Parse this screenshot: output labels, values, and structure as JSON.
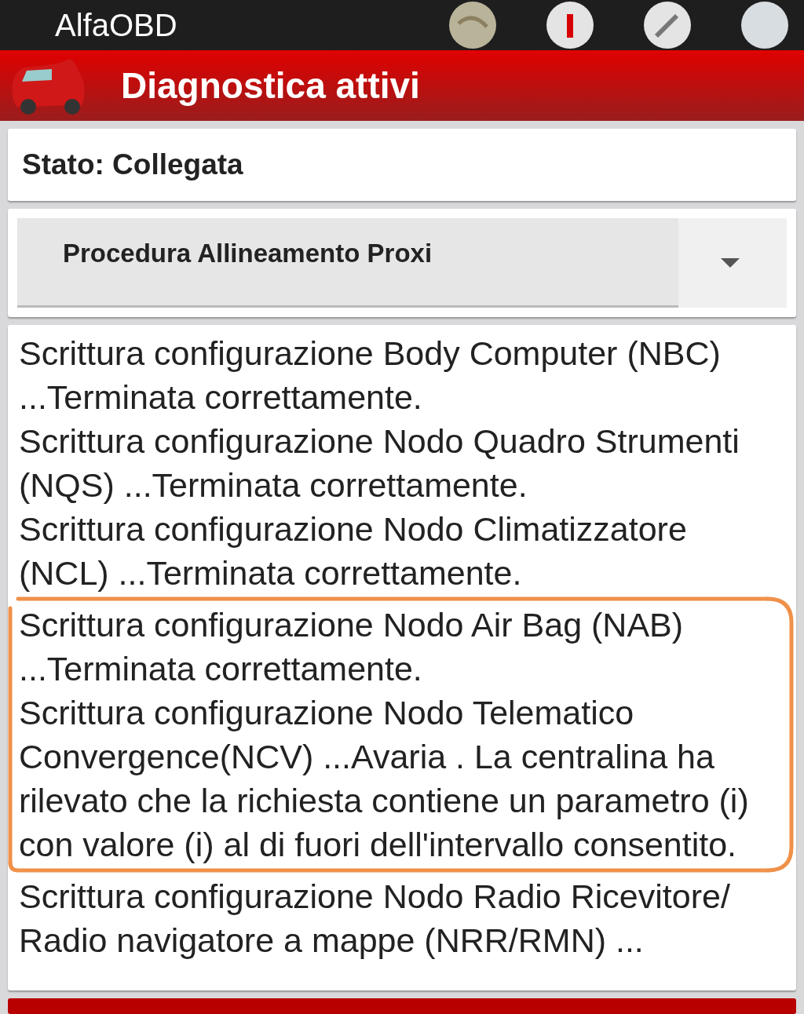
{
  "app_bar": {
    "title": "AlfaOBD"
  },
  "header": {
    "title": "Diagnostica attivi"
  },
  "status": {
    "text": "Stato: Collegata"
  },
  "procedure_select": {
    "value": "Procedura Allineamento Proxi"
  },
  "log": [
    {
      "text": "Scrittura configurazione Body Computer (NBC) ...Terminata correttamente."
    },
    {
      "text": "Scrittura configurazione Nodo Quadro Strumenti (NQS) ...Terminata correttamente."
    },
    {
      "text": "Scrittura configurazione Nodo Climatizzatore (NCL) ...Terminata correttamente."
    },
    {
      "text": "Scrittura configurazione Nodo Air Bag (NAB) ...Terminata correttamente."
    },
    {
      "text": "Scrittura configurazione Nodo Telematico Convergence(NCV) ...Avaria . La centralina ha rilevato che la richiesta contiene un parametro (i) con valore (i) al di fuori dell'intervallo consentito."
    },
    {
      "text": "Scrittura configurazione Nodo Radio Ricevitore/ Radio navigatore a mappe (NRR/RMN) ..."
    }
  ]
}
